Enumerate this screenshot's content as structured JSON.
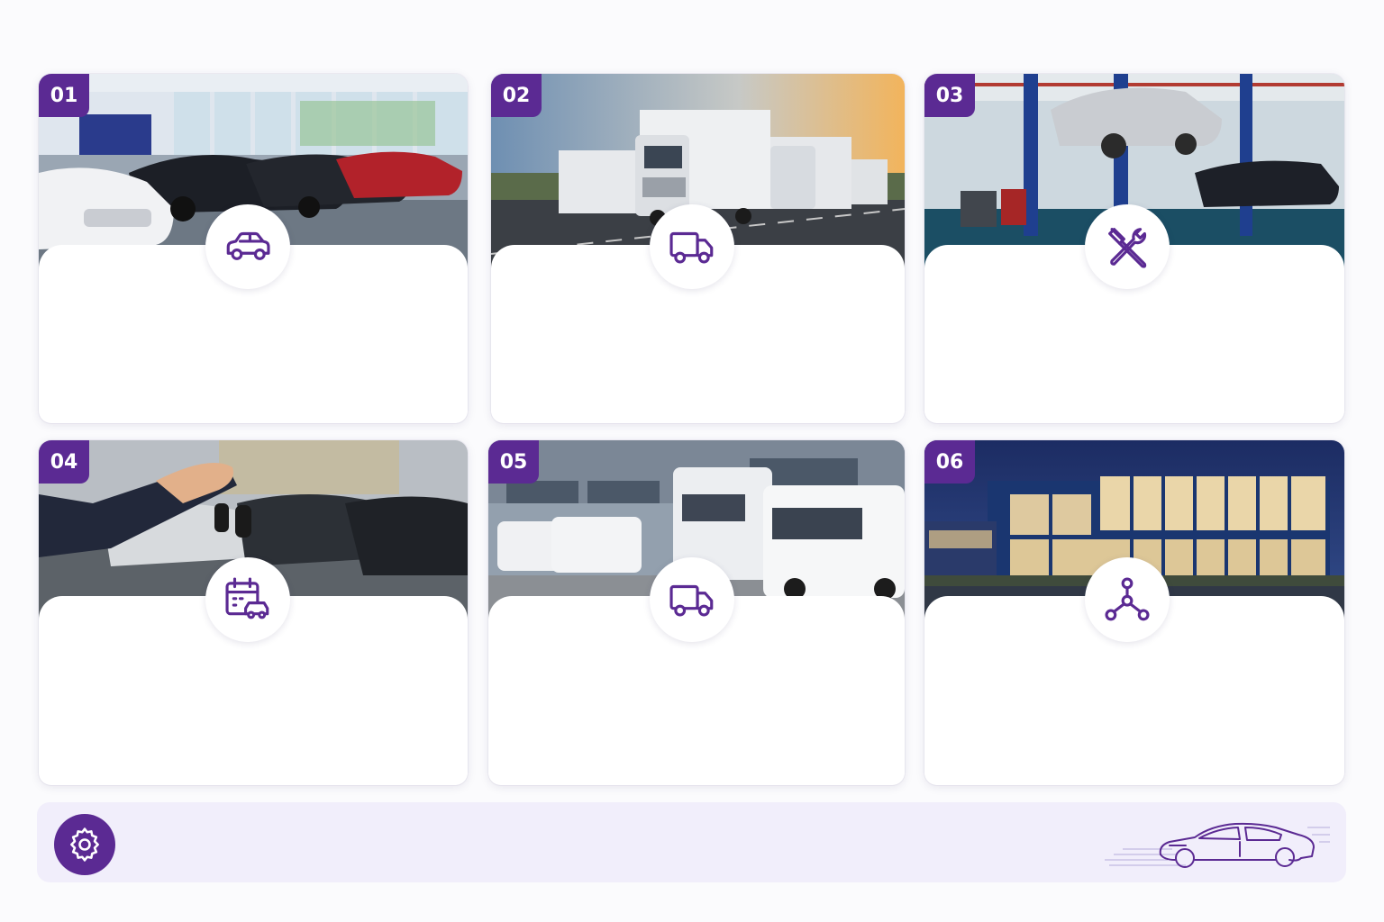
{
  "accent_color": "#5b2a93",
  "cards": [
    {
      "number": "01",
      "icon": "car-icon",
      "photo": "car-showroom"
    },
    {
      "number": "02",
      "icon": "truck-icon",
      "photo": "truck-fleet-highway"
    },
    {
      "number": "03",
      "icon": "wrench-screwdriver-icon",
      "photo": "service-workshop"
    },
    {
      "number": "04",
      "icon": "calendar-car-icon",
      "photo": "car-keys-handover"
    },
    {
      "number": "05",
      "icon": "truck-icon",
      "photo": "van-and-truck-depot"
    },
    {
      "number": "06",
      "icon": "network-nodes-icon",
      "photo": "dealership-building-night"
    }
  ],
  "footer": {
    "icon": "gear-icon",
    "illustration": "car-outline-icon"
  }
}
